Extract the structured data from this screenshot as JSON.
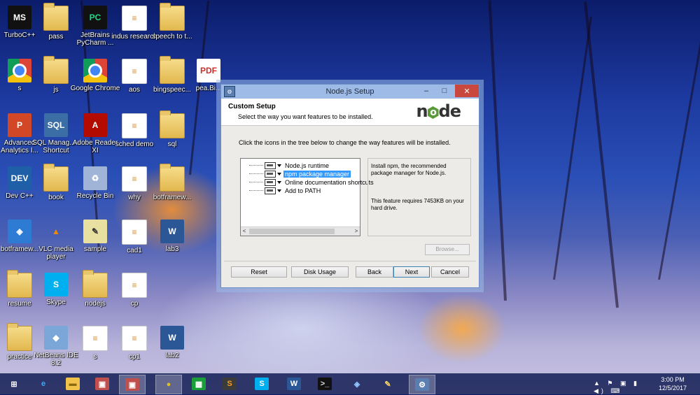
{
  "desktop_icons": [
    {
      "label": "TurboC++",
      "icon": "turbo-c-icon"
    },
    {
      "label": "pass",
      "icon": "folder-icon"
    },
    {
      "label": "JetBrains PyCharm ...",
      "icon": "pycharm-icon"
    },
    {
      "label": "indus research",
      "icon": "document-icon"
    },
    {
      "label": "speech to t...",
      "icon": "folder-icon"
    },
    {
      "label": "s",
      "icon": "chrome-icon"
    },
    {
      "label": "js",
      "icon": "folder-icon"
    },
    {
      "label": "Google Chrome",
      "icon": "chrome-icon"
    },
    {
      "label": "aos",
      "icon": "document-icon"
    },
    {
      "label": "bingspeec...",
      "icon": "folder-icon"
    },
    {
      "label": "pea.Bi...",
      "icon": "pdf-icon"
    },
    {
      "label": "Advanced Analytics I...",
      "icon": "powerpoint-icon"
    },
    {
      "label": "SQL Manag... - Shortcut",
      "icon": "sql-manager-icon"
    },
    {
      "label": "Adobe Reader XI",
      "icon": "adobe-reader-icon"
    },
    {
      "label": "sched demo",
      "icon": "document-icon"
    },
    {
      "label": "sql",
      "icon": "folder-icon"
    },
    {
      "label": "Dev C++",
      "icon": "dev-cpp-icon"
    },
    {
      "label": "book",
      "icon": "folder-icon"
    },
    {
      "label": "Recycle Bin",
      "icon": "recycle-bin-icon"
    },
    {
      "label": "why",
      "icon": "document-icon"
    },
    {
      "label": "botframew...",
      "icon": "folder-icon"
    },
    {
      "label": "botframew...",
      "icon": "botframework-icon"
    },
    {
      "label": "VLC media player",
      "icon": "vlc-icon"
    },
    {
      "label": "sample",
      "icon": "notepad-icon"
    },
    {
      "label": "cad1",
      "icon": "document-icon"
    },
    {
      "label": "lab3",
      "icon": "word-icon"
    },
    {
      "label": "resume",
      "icon": "folder-icon"
    },
    {
      "label": "Skype",
      "icon": "skype-icon"
    },
    {
      "label": "nodejs",
      "icon": "folder-icon"
    },
    {
      "label": "cp",
      "icon": "document-icon"
    },
    {
      "label": "practice",
      "icon": "folder-icon"
    },
    {
      "label": "NetBeans IDE 8.2",
      "icon": "netbeans-icon"
    },
    {
      "label": "s",
      "icon": "document-icon"
    },
    {
      "label": "cp1",
      "icon": "document-icon"
    },
    {
      "label": "lab2",
      "icon": "word-icon"
    }
  ],
  "dialog": {
    "title": "Node.js Setup",
    "minimize": "–",
    "maximize": "□",
    "close": "✕",
    "heading": "Custom Setup",
    "subheading": "Select the way you want features to be installed.",
    "logo_text_n": "n",
    "logo_text_o": "o",
    "logo_text_de": "de",
    "instructions": "Click the icons in the tree below to change the way features will be installed.",
    "features": [
      {
        "label": "Node.js runtime",
        "selected": false
      },
      {
        "label": "npm package manager",
        "selected": true
      },
      {
        "label": "Online documentation shortcuts",
        "selected": false
      },
      {
        "label": "Add to PATH",
        "selected": false
      }
    ],
    "description": "Install npm, the recommended package manager for Node.js.",
    "requirement": "This feature requires 7453KB on your hard drive.",
    "browse": "Browse...",
    "buttons": {
      "reset": "Reset",
      "disk_usage": "Disk Usage",
      "back": "Back",
      "next": "Next",
      "cancel": "Cancel"
    }
  },
  "taskbar": {
    "items": [
      "start-icon",
      "internet-explorer-icon",
      "file-explorer-icon",
      "app-icon",
      "app-icon",
      "chrome-icon",
      "store-icon",
      "sublime-icon",
      "skype-icon",
      "word-icon",
      "cmd-icon",
      "botframework-icon",
      "paint-icon",
      "installer-icon"
    ],
    "time": "3:00 PM",
    "date": "12/5/2017"
  }
}
